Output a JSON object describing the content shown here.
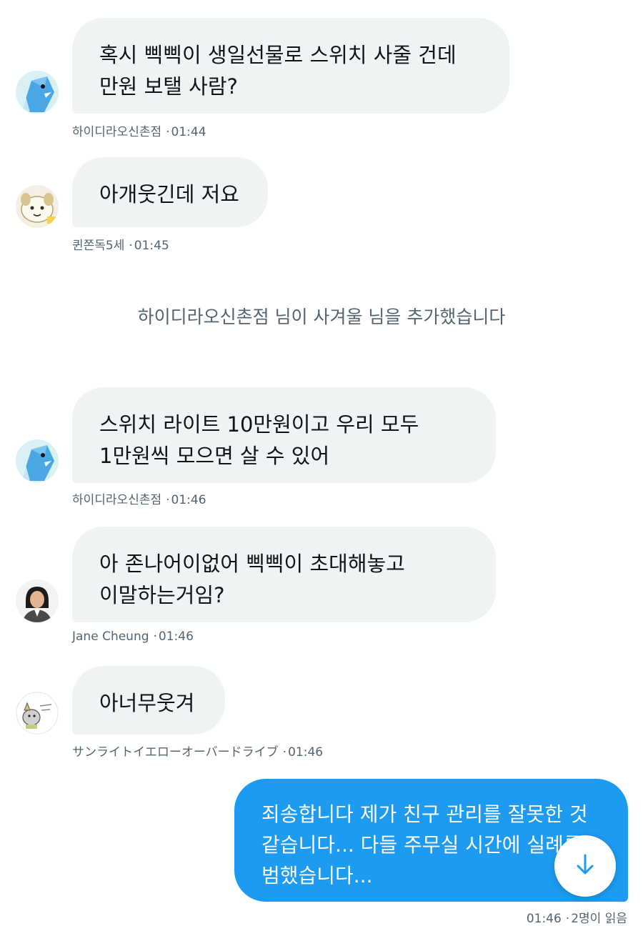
{
  "messages": [
    {
      "text": "혹시 삑삑이 생일선물로 스위치 사줄 건데 만원 보탤 사람?",
      "sender": "하이디라오신촌점",
      "time": "01:44",
      "avatar_icon": "blue-bird-avatar-icon"
    },
    {
      "text": "아개웃긴데 저요",
      "sender": "퀸쫀독5세",
      "time": "01:45",
      "avatar_icon": "cartoon-dog-avatar-icon"
    },
    {
      "text": "스위치 라이트 10만원이고 우리 모두 1만원씩 모으면 살 수 있어",
      "sender": "하이디라오신촌점",
      "time": "01:46",
      "avatar_icon": "blue-bird-avatar-icon"
    },
    {
      "text": "아 존나어이없어 삑삑이 초대해놓고 이말하는거임?",
      "sender": "Jane Cheung",
      "time": "01:46",
      "avatar_icon": "person-photo-avatar-icon"
    },
    {
      "text": "아너무웃겨",
      "sender": "サンライトイエローオーバードライブ",
      "time": "01:46",
      "avatar_icon": "sketch-animal-avatar-icon"
    }
  ],
  "system_message": "하이디라오신촌점 님이 사겨울 님을 추가했습니다",
  "my_message": {
    "text": "죄송합니다 제가 친구 관리를 잘못한 것 같습니다... 다들 주무실 시간에 실례를 범했습니다...",
    "time": "01:46",
    "read_status": "2명이 읽음"
  },
  "meta_separator": "·",
  "colors": {
    "accent": "#1d9bf0",
    "bubble_gray": "#eff3f4",
    "meta_text": "#536471"
  },
  "scroll_button": {
    "icon": "arrow-down-icon"
  }
}
